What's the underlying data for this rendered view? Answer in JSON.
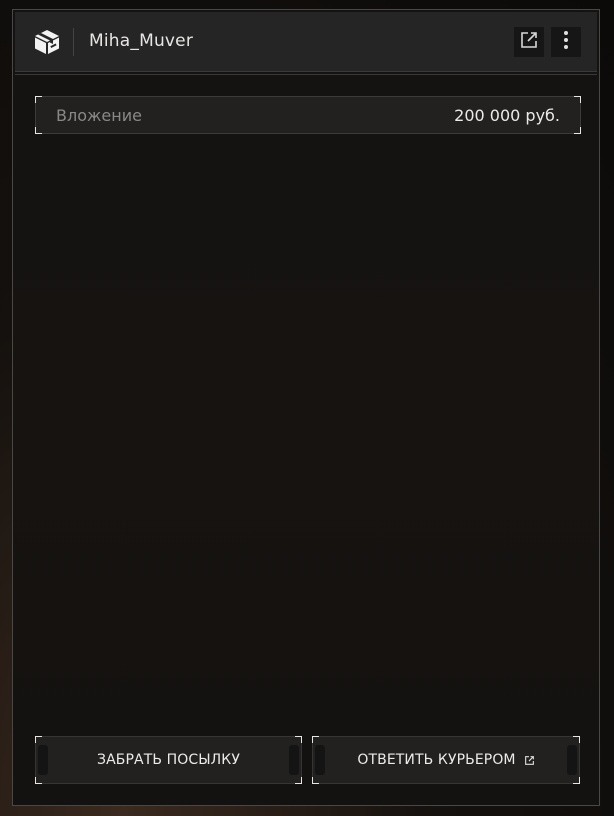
{
  "header": {
    "title": "Miha_Muver",
    "icons": {
      "app": "package-box-icon",
      "open_external": "external-link-icon",
      "more": "more-vertical-icon"
    }
  },
  "investment": {
    "label": "Вложение",
    "value": "200 000 руб."
  },
  "actions": {
    "take_parcel": "ЗАБРАТЬ ПОСЫЛКУ",
    "reply_courier": "ОТВЕТИТЬ КУРЬЕРОМ"
  },
  "colors": {
    "header_bg": "#252525",
    "text_primary": "#eceae7",
    "text_muted": "#8a8886",
    "corner_accent": "#e6e6e6"
  }
}
